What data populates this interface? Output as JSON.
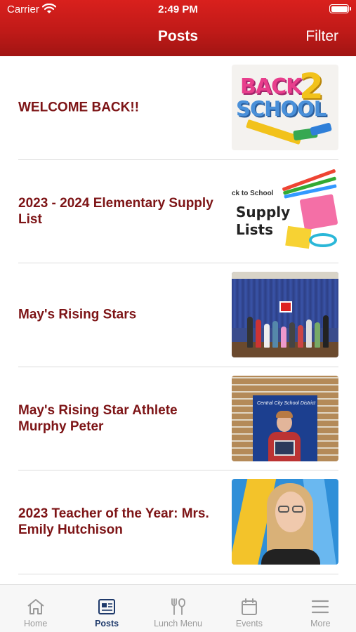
{
  "status_bar": {
    "carrier": "Carrier",
    "time": "2:49 PM"
  },
  "header": {
    "title": "Posts",
    "filter_label": "Filter"
  },
  "posts": [
    {
      "title": "WELCOME BACK!!"
    },
    {
      "title": "2023 - 2024 Elementary Supply List"
    },
    {
      "title": "May's Rising Stars"
    },
    {
      "title": "May's Rising Star Athlete Murphy Peter"
    },
    {
      "title": "2023 Teacher of the Year: Mrs. Emily Hutchison"
    }
  ],
  "thumbnails": {
    "back_to_school": {
      "word1": "BACK",
      "word2": "2",
      "word3": "SCHOOL"
    },
    "supply_list": {
      "line1": "ck to School",
      "line2": "Supply",
      "line3": "Lists"
    },
    "rising_star_banner": "Central City School District"
  },
  "tabbar": {
    "items": [
      {
        "label": "Home",
        "icon": "home-icon",
        "active": false
      },
      {
        "label": "Posts",
        "icon": "newspaper-icon",
        "active": true
      },
      {
        "label": "Lunch Menu",
        "icon": "utensils-icon",
        "active": false
      },
      {
        "label": "Events",
        "icon": "calendar-icon",
        "active": false
      },
      {
        "label": "More",
        "icon": "menu-icon",
        "active": false
      }
    ]
  },
  "colors": {
    "header_red": "#c01a18",
    "post_title": "#7d1416",
    "tab_active": "#1f3a6b",
    "tab_inactive": "#9a9a9a"
  }
}
